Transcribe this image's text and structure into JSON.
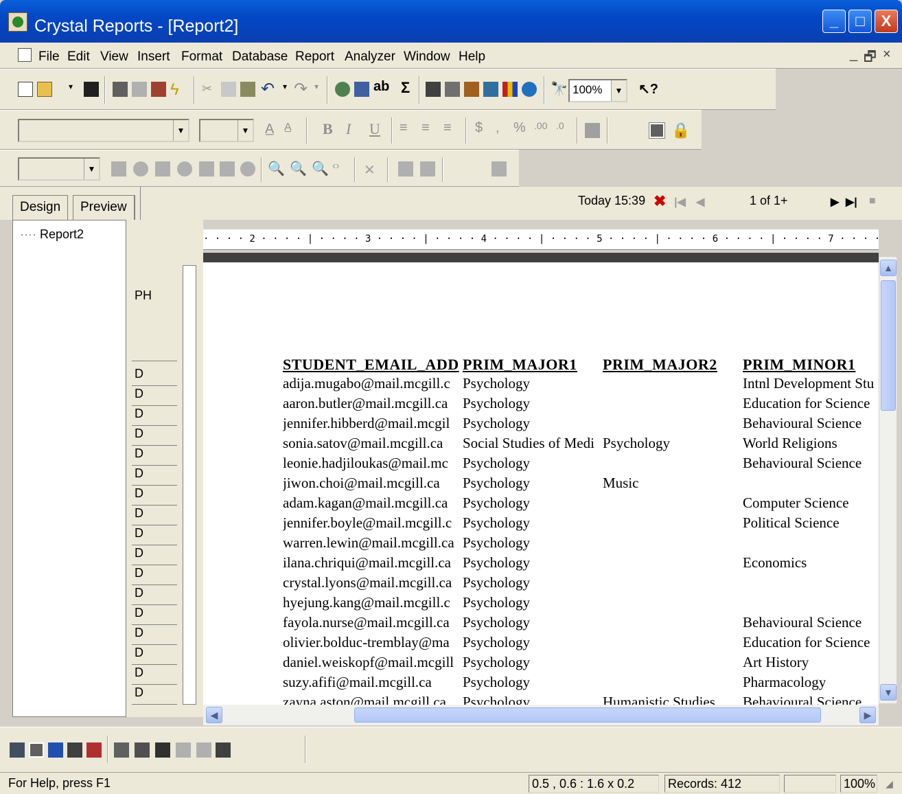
{
  "window": {
    "title": "Crystal Reports - [Report2]",
    "minimize": "_",
    "maximize": "□",
    "close": "X"
  },
  "menu": {
    "items": [
      "File",
      "Edit",
      "View",
      "Insert",
      "Format",
      "Database",
      "Report",
      "Analyzer",
      "Window",
      "Help"
    ],
    "mdi_controls": [
      "_",
      "ð",
      "×"
    ]
  },
  "toolbar": {
    "zoom_value": "100%"
  },
  "tabs": {
    "design": "Design",
    "preview": "Preview"
  },
  "navigation": {
    "date_label": "Today 15:39",
    "page_indicator": "1 of 1+"
  },
  "tree": {
    "root": "Report2"
  },
  "sections": {
    "page_header": "PH",
    "detail": "D"
  },
  "ruler": {
    "marks": "· · · · 2 · · · · | · · · · 3 · · · · | · · · · 4 · · · · | · · · · 5 · · · · | · · · · 6 · · · · | · · · · 7 · · · · | · · · ·"
  },
  "report": {
    "columns": [
      "STUDENT_EMAIL_ADD",
      "PRIM_MAJOR1",
      "PRIM_MAJOR2",
      "PRIM_MINOR1"
    ],
    "rows": [
      [
        "adija.mugabo@mail.mcgill.c",
        "Psychology",
        "",
        "Intnl Development Stu"
      ],
      [
        "aaron.butler@mail.mcgill.ca",
        "Psychology",
        "",
        "Education for Science"
      ],
      [
        "jennifer.hibberd@mail.mcgil",
        "Psychology",
        "",
        "Behavioural Science"
      ],
      [
        "sonia.satov@mail.mcgill.ca",
        "Social Studies of Medi",
        "Psychology",
        "World Religions"
      ],
      [
        "leonie.hadjiloukas@mail.mc",
        "Psychology",
        "",
        "Behavioural Science"
      ],
      [
        "jiwon.choi@mail.mcgill.ca",
        "Psychology",
        "Music",
        ""
      ],
      [
        "adam.kagan@mail.mcgill.ca",
        "Psychology",
        "",
        "Computer Science"
      ],
      [
        "jennifer.boyle@mail.mcgill.c",
        "Psychology",
        "",
        "Political Science"
      ],
      [
        "warren.lewin@mail.mcgill.ca",
        "Psychology",
        "",
        ""
      ],
      [
        "ilana.chriqui@mail.mcgill.ca",
        "Psychology",
        "",
        "Economics"
      ],
      [
        "crystal.lyons@mail.mcgill.ca",
        "Psychology",
        "",
        ""
      ],
      [
        "hyejung.kang@mail.mcgill.c",
        "Psychology",
        "",
        ""
      ],
      [
        "fayola.nurse@mail.mcgill.ca",
        "Psychology",
        "",
        "Behavioural Science"
      ],
      [
        "olivier.bolduc-tremblay@ma",
        "Psychology",
        "",
        "Education for Science"
      ],
      [
        "daniel.weiskopf@mail.mcgill",
        "Psychology",
        "",
        "Art History"
      ],
      [
        "suzy.afifi@mail.mcgill.ca",
        "Psychology",
        "",
        "Pharmacology"
      ],
      [
        "zayna.aston@mail.mcgill.ca",
        "Psychology",
        "Humanistic Studies",
        "Behavioural Science"
      ]
    ]
  },
  "status": {
    "help": "For Help, press F1",
    "position": "0.5 , 0.6 : 1.6 x 0.2",
    "records": "Records: 412",
    "zoom": "100%"
  },
  "colors": {
    "titlebar": "#0247c5",
    "chrome": "#ece9d8",
    "close_icon": "#cc0000"
  }
}
